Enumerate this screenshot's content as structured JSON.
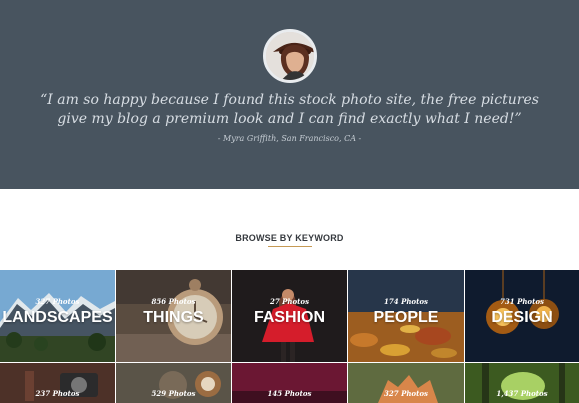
{
  "testimonial": {
    "quote": "“I am so happy because I found this stock photo site, the free pictures give my blog a premium look and I can find exactly what I need!”",
    "author": "- Myra Griffith, San Francisco, CA -"
  },
  "browse": {
    "heading": "BROWSE BY KEYWORD",
    "accent_color": "#c69a55"
  },
  "keywords": [
    {
      "name": "LANDSCAPES",
      "count": "327 Photos"
    },
    {
      "name": "THINGS",
      "count": "856 Photos"
    },
    {
      "name": "FASHION",
      "count": "27 Photos"
    },
    {
      "name": "PEOPLE",
      "count": "174 Photos"
    },
    {
      "name": "DESIGN",
      "count": "731 Photos"
    },
    {
      "name": "",
      "count": "237 Photos"
    },
    {
      "name": "",
      "count": "529 Photos"
    },
    {
      "name": "",
      "count": "145 Photos"
    },
    {
      "name": "",
      "count": "327 Photos"
    },
    {
      "name": "",
      "count": "1,437 Photos"
    }
  ]
}
